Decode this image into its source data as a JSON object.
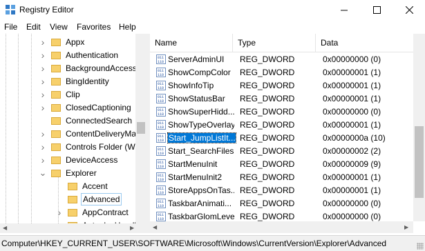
{
  "window": {
    "title": "Registry Editor"
  },
  "menu": [
    "File",
    "Edit",
    "View",
    "Favorites",
    "Help"
  ],
  "tree": {
    "items": [
      {
        "label": "Appx",
        "expander": "collapsed",
        "level": 1
      },
      {
        "label": "Authentication",
        "expander": "collapsed",
        "level": 1
      },
      {
        "label": "BackgroundAccess",
        "expander": "collapsed",
        "level": 1
      },
      {
        "label": "BingIdentity",
        "expander": "collapsed",
        "level": 1
      },
      {
        "label": "Clip",
        "expander": "collapsed",
        "level": 1
      },
      {
        "label": "ClosedCaptioning",
        "expander": "collapsed",
        "level": 1
      },
      {
        "label": "ConnectedSearch",
        "expander": "none",
        "level": 1
      },
      {
        "label": "ContentDeliveryMa",
        "expander": "collapsed",
        "level": 1
      },
      {
        "label": "Controls Folder (W",
        "expander": "collapsed",
        "level": 1
      },
      {
        "label": "DeviceAccess",
        "expander": "collapsed",
        "level": 1
      },
      {
        "label": "Explorer",
        "expander": "expanded",
        "level": 1
      },
      {
        "label": "Accent",
        "expander": "none",
        "level": 2
      },
      {
        "label": "Advanced",
        "expander": "none",
        "level": 2,
        "selected": true
      },
      {
        "label": "AppContract",
        "expander": "collapsed",
        "level": 2
      },
      {
        "label": "AutoplayHandl",
        "expander": "collapsed",
        "level": 2
      }
    ]
  },
  "list": {
    "columns": [
      "Name",
      "Type",
      "Data"
    ],
    "rows": [
      {
        "name": "ServerAdminUI",
        "type": "REG_DWORD",
        "data": "0x00000000 (0)"
      },
      {
        "name": "ShowCompColor",
        "type": "REG_DWORD",
        "data": "0x00000001 (1)"
      },
      {
        "name": "ShowInfoTip",
        "type": "REG_DWORD",
        "data": "0x00000001 (1)"
      },
      {
        "name": "ShowStatusBar",
        "type": "REG_DWORD",
        "data": "0x00000001 (1)"
      },
      {
        "name": "ShowSuperHidd...",
        "type": "REG_DWORD",
        "data": "0x00000000 (0)"
      },
      {
        "name": "ShowTypeOverlay",
        "type": "REG_DWORD",
        "data": "0x00000001 (1)"
      },
      {
        "name": "Start_JumpListIt...",
        "type": "REG_DWORD",
        "data": "0x0000000a (10)",
        "selected": true
      },
      {
        "name": "Start_SearchFiles",
        "type": "REG_DWORD",
        "data": "0x00000002 (2)"
      },
      {
        "name": "StartMenuInit",
        "type": "REG_DWORD",
        "data": "0x00000009 (9)"
      },
      {
        "name": "StartMenuInit2",
        "type": "REG_DWORD",
        "data": "0x00000001 (1)"
      },
      {
        "name": "StoreAppsOnTas...",
        "type": "REG_DWORD",
        "data": "0x00000001 (1)"
      },
      {
        "name": "TaskbarAnimati...",
        "type": "REG_DWORD",
        "data": "0x00000000 (0)"
      },
      {
        "name": "TaskbarGlomLevel",
        "type": "REG_DWORD",
        "data": "0x00000000 (0)"
      }
    ]
  },
  "status": {
    "path": "Computer\\HKEY_CURRENT_USER\\SOFTWARE\\Microsoft\\Windows\\CurrentVersion\\Explorer\\Advanced"
  },
  "colors": {
    "selection": "#0078d7",
    "folder": "#f7d06b",
    "chrome": "#f0f0f0"
  }
}
